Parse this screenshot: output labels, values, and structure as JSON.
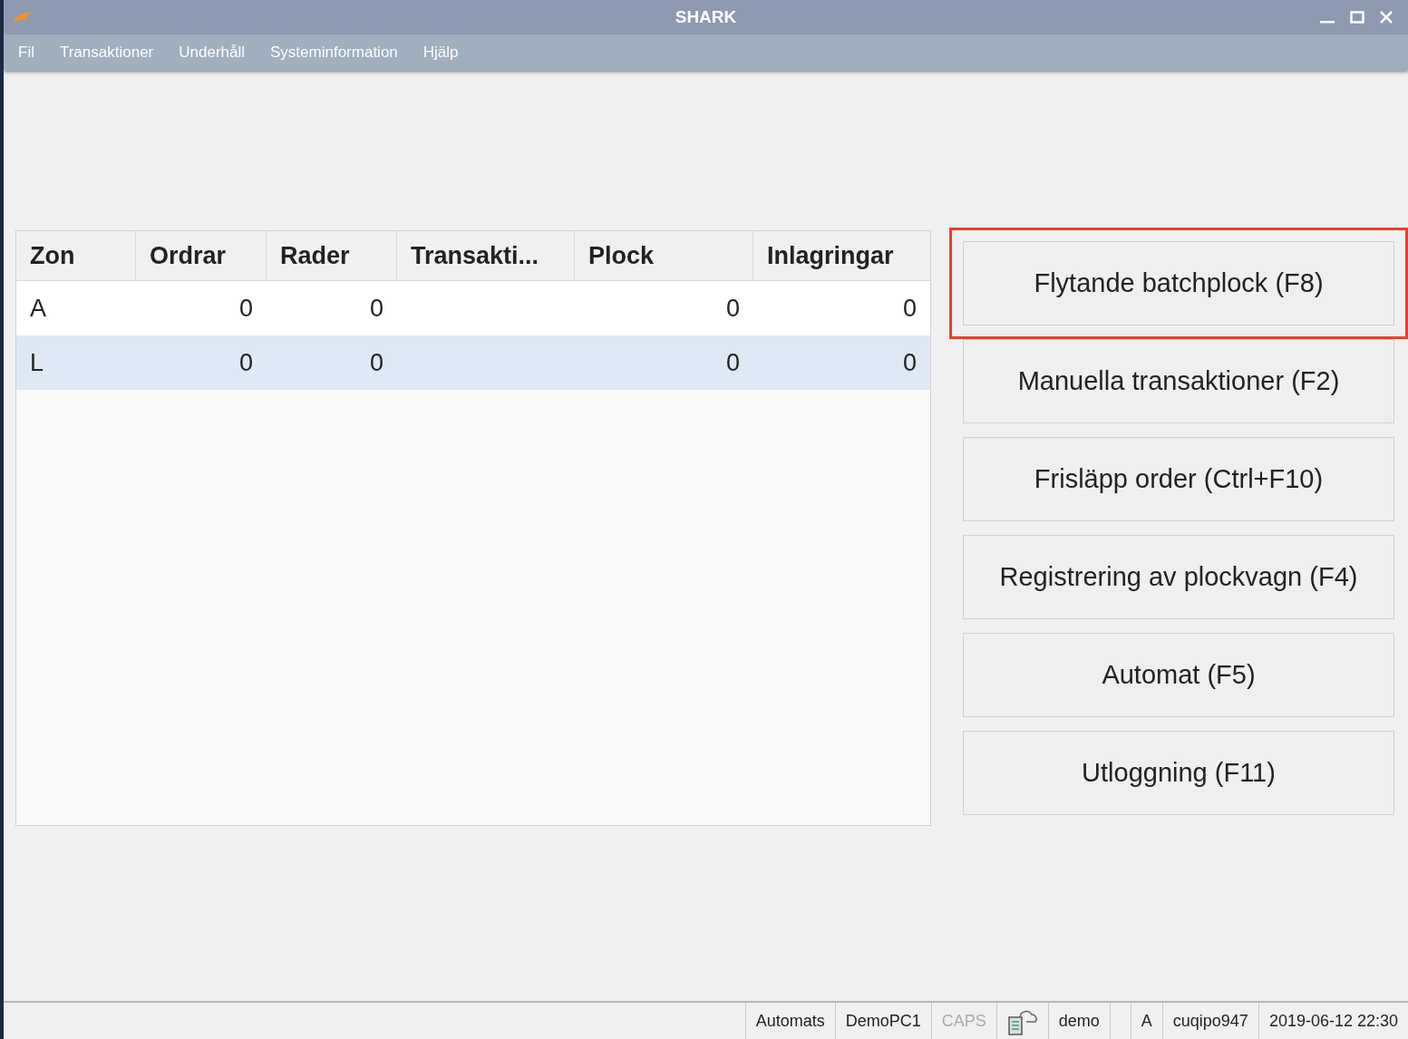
{
  "window": {
    "title": "SHARK"
  },
  "menu": [
    "Fil",
    "Transaktioner",
    "Underhåll",
    "Systeminformation",
    "Hjälp"
  ],
  "table": {
    "columns": [
      "Zon",
      "Ordrar",
      "Rader",
      "Transakti...",
      "Plock",
      "Inlagringar"
    ],
    "rows": [
      {
        "cells": [
          "A",
          "0",
          "0",
          "",
          "0",
          "0"
        ],
        "selected": false
      },
      {
        "cells": [
          "L",
          "0",
          "0",
          "",
          "0",
          "0"
        ],
        "selected": true
      }
    ]
  },
  "actions": [
    {
      "label": "Flytande batchplock (F8)",
      "highlighted": true
    },
    {
      "label": "Manuella transaktioner (F2)",
      "highlighted": false
    },
    {
      "label": "Frisläpp order (Ctrl+F10)",
      "highlighted": false
    },
    {
      "label": "Registrering av plockvagn (F4)",
      "highlighted": false
    },
    {
      "label": "Automat (F5)",
      "highlighted": false
    },
    {
      "label": "Utloggning (F11)",
      "highlighted": false
    }
  ],
  "status_bar": [
    {
      "kind": "text",
      "text": "Automats",
      "active": true
    },
    {
      "kind": "text",
      "text": "DemoPC1",
      "active": true
    },
    {
      "kind": "text",
      "text": "CAPS",
      "active": false
    },
    {
      "kind": "icon"
    },
    {
      "kind": "text",
      "text": "demo",
      "active": true
    },
    {
      "kind": "empty"
    },
    {
      "kind": "text",
      "text": "A",
      "active": true
    },
    {
      "kind": "text",
      "text": "cuqipo947",
      "active": true
    },
    {
      "kind": "text",
      "text": "2019-06-12 22:30",
      "active": true
    }
  ]
}
